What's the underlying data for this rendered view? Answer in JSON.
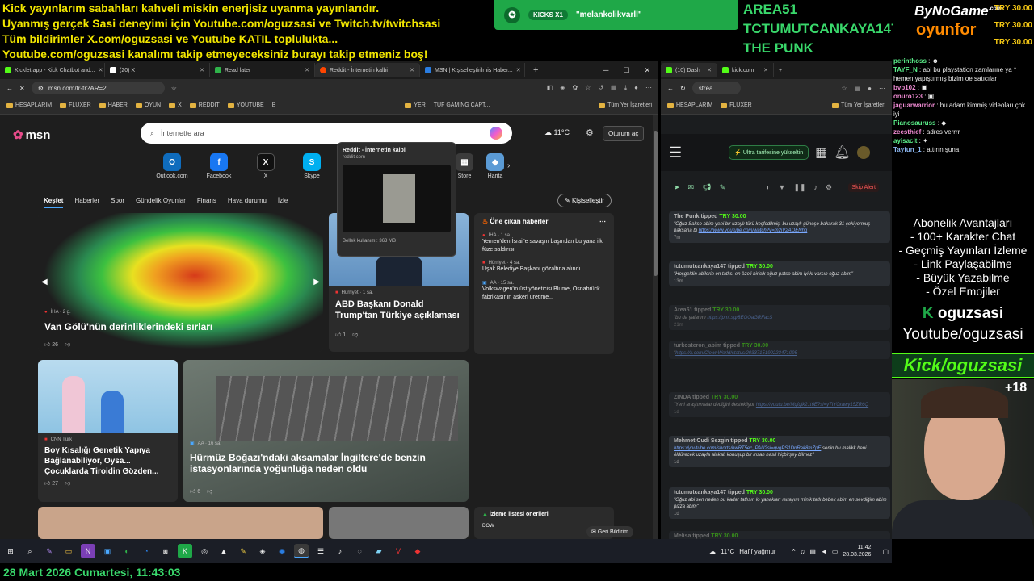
{
  "banner": {
    "lines": [
      "Kick yayınlarım sabahları kahveli miskin enerjisiz uyanma yayınlarıdır.",
      "Uyanmış gerçek Sasi deneyimi için Youtube.com/oguzsasi ve Twitch.tv/twitchsasi",
      "Tüm bildirimler X.com/oguzsasi ve Youtube KATIL toplulukta...",
      "Youtube.com/oguzsasi kanalımı takip etmeyeceksiniz burayı takip etmeniz boş!"
    ]
  },
  "kick_alert": {
    "badge": "KICKS X1",
    "user": "\"melankolikvarll\""
  },
  "top_names": [
    "AREA51",
    "TCTUMUTCANKAYA147",
    "THE PUNK"
  ],
  "sponsor": {
    "line1": "ByNoGame",
    "line1_sup": ".com",
    "line2": "oyunfor"
  },
  "top_tips": [
    "TRY 30.00",
    "TRY 30.00",
    "TRY 30.00"
  ],
  "browser": {
    "tabs": [
      {
        "label": "Kicklet.app - Kick Chatbot and...",
        "color": "#53fc18"
      },
      {
        "label": "(20) X",
        "color": "#ffffff"
      },
      {
        "label": "Read later",
        "color": "#2fb34a"
      },
      {
        "label": "Reddit - İnternetin kalbi",
        "color": "#ff4500"
      },
      {
        "label": "MSN | Kişiselleştirilmiş Haber...",
        "color": "#2a7de1"
      }
    ],
    "url": "msn.com/tr-tr?AR=2",
    "bookmarks": [
      "HESAPLARIM",
      "FLUXER",
      "HABER",
      "OYUN",
      "X",
      "REDDIT",
      "YOUTUBE",
      "B",
      "YER",
      "TUF GAMING CAPT...",
      "Tüm Yer İşaretleri"
    ],
    "popup": {
      "title": "Reddit - İnternetin kalbi",
      "domain": "reddit.com",
      "memory": "Bellek kullanımı: 363 MB"
    }
  },
  "msn": {
    "logo": "msn",
    "search_placeholder": "İnternette ara",
    "weather": "11°C",
    "signin": "Oturum aç",
    "quick_links": [
      {
        "label": "Outlook.com",
        "color": "#0f6cbd",
        "glyph": "O"
      },
      {
        "label": "Facebook",
        "color": "#1877f2",
        "glyph": "f"
      },
      {
        "label": "X",
        "color": "#111111",
        "glyph": "X"
      },
      {
        "label": "Skype",
        "color": "#00aff0",
        "glyph": "S"
      },
      {
        "label": "Store",
        "color": "#3b3b3b",
        "glyph": "▦"
      },
      {
        "label": "Harita",
        "color": "#5b9bd5",
        "glyph": "◆"
      }
    ],
    "categories": [
      "Keşfet",
      "Haberler",
      "Spor",
      "Gündelik Oyunlar",
      "Finans",
      "Hava durumu",
      "İzle"
    ],
    "customize": "Kişiselleştir",
    "hero": {
      "source": "İHA · 2 g.",
      "title": "Van Gölü'nün derinliklerindeki sırları",
      "likes": "26"
    },
    "card_trump": {
      "source": "Hürriyet · 1 sa.",
      "title": "ABD Başkanı Donald Trump'tan Türkiye açıklaması",
      "likes": "1"
    },
    "top_stories": {
      "header": "Öne çıkan haberler",
      "items": [
        {
          "source": "İHA · 1 sa.",
          "title": "Yemen'den İsrail'e savaşın başından bu yana ilk füze saldırısı"
        },
        {
          "source": "Hürriyet · 4 sa.",
          "title": "Uşak Belediye Başkanı gözaltına alındı"
        },
        {
          "source": "AA · 15 sa.",
          "title": "Volkswagen'in üst yöneticisi Blume, Osnabrück fabrikasının askeri üretime..."
        }
      ]
    },
    "card_kids": {
      "source": "CNN Türk",
      "title": "Boy Kısalığı Genetik Yapıya Bağlanabiliyor, Oysa... Çocuklarda Tiroidin Gözden...",
      "likes": "27"
    },
    "card_bosphorus": {
      "source": "AA · 16 sa.",
      "title": "Hürmüz Boğazı'ndaki aksamalar İngiltere'de benzin istasyonlarında yoğunluğa neden oldu",
      "likes": "6"
    },
    "watchlist": "İzleme listesi önerileri",
    "watch_dow": "DOW",
    "feedback": "Geri Bildirim"
  },
  "kick_panel": {
    "tab1": "(10) Dash",
    "tab2": "kick.com",
    "url": "strea...",
    "bookmarks": [
      "HESAPLARIM",
      "FLUXER",
      "Tüm Yer İşaretleri"
    ],
    "upgrade": "Ultra tarifesine yükseltin",
    "skip": "Skip Alert",
    "tips": [
      {
        "user": "The Punk",
        "amount": "TRY 30.00",
        "msg": "\"Oğuz Sakso abim yeni bir uzaylı türü keşfedilmiş, bu uzaylı güneşe bakarak 31 çekiyormuş baksana bi ",
        "link": "https://www.youtube.com/watch?v=m2jV2AQENhg",
        "time": "7m",
        "dim": false
      },
      {
        "user": "tctumutcankaya147",
        "amount": "TRY 30.00",
        "msg": "\"Hoşgeldin abilerin en tatlısı en özeli biricik oğuz patso abim iyi ki varsın oğuz abim\"",
        "link": "",
        "time": "13m",
        "dim": false
      },
      {
        "user": "Area51",
        "amount": "TRY 30.00",
        "msg": "\"bu da yalanını ",
        "link": "https://pmt.sg/8EGOaGRFacS",
        "time": "21m",
        "dim": true
      },
      {
        "user": "turkosteron_abim",
        "amount": "TRY 30.00",
        "msg": "\"",
        "link": "https://x.com/ClownWorld/status/2033715190223471095",
        "time": "",
        "dim": true
      },
      {
        "user": "ZINDA",
        "amount": "TRY 30.00",
        "msg": "\"Yeni araştırmalar dediğini destekliyor ",
        "link": "https://youtu.be/Mgfglk21t6E?si=yTIY0xawy15ZR6Q",
        "time": "1d",
        "dim": true
      },
      {
        "user": "Mehmet Cudi Sezgin",
        "amount": "TRY 30.00",
        "msg": "senin bu malikk beni öldürecek uzayla alakalı konuşup bir insan nasıl hiçbirşey bilmez\"",
        "link": "https://youtube.com/shorts/nwRT5ec_PAU?si=qvgPS1DnRek8mZpE",
        "time": "1d",
        "dim": false
      },
      {
        "user": "tctumutcankaya147",
        "amount": "TRY 30.00",
        "msg": "\"Oğuz abi sen neden bu kadar tatlısın lo yanakları ısırayım minik tatlı bebek abim en sevdiğim abim pizza abim\"",
        "link": "",
        "time": "1d",
        "dim": false
      },
      {
        "user": "Melisa",
        "amount": "TRY 30.00",
        "msg": "",
        "link": "",
        "time": "",
        "dim": true
      }
    ]
  },
  "chat": [
    {
      "user": "perinthoss",
      "text": " : ☻",
      "cls": "u"
    },
    {
      "user": "TAYF_N",
      "text": " : abi bu playstation zamlarıne ya * hemen yapıştırmış bizim oe satıcılar",
      "cls": "u"
    },
    {
      "user": "bvb102",
      "text": " : ▣",
      "cls": "u2"
    },
    {
      "user": "onuro123",
      "text": " : ▣",
      "cls": "u2"
    },
    {
      "user": "jaguarwarrior",
      "text": " : bu adam kimmiş videoları çok iyi",
      "cls": "u2"
    },
    {
      "user": "Pianosauruss",
      "text": " : ◆",
      "cls": "u"
    },
    {
      "user": "zeesthief",
      "text": " : adres verrrr",
      "cls": "u2"
    },
    {
      "user": "ayisacit",
      "text": " : ✦",
      "cls": "u"
    },
    {
      "user": "Tayfun_1",
      "text": " : attırın şuna",
      "cls": "u3"
    }
  ],
  "perks": [
    "Abonelik Avantajları",
    "- 100+ Karakter Chat",
    "- Geçmiş Yayınları İzleme",
    "- Link Paylaşabilme",
    "- Büyük Yazabilme",
    "- Özel Emojiler"
  ],
  "brand_name": "oguzsasi",
  "youtube_handle": "Youtube/oguzsasi",
  "kick_handle": "Kick/oguzsasi",
  "age_badge": "+18",
  "taskbar": {
    "weather_temp": "11°C",
    "weather_text": "Hafif yağmur",
    "time": "11:42",
    "date": "28.03.2026"
  },
  "datetime_footer": "28 Mart 2026 Cumartesi, 11:43:03"
}
